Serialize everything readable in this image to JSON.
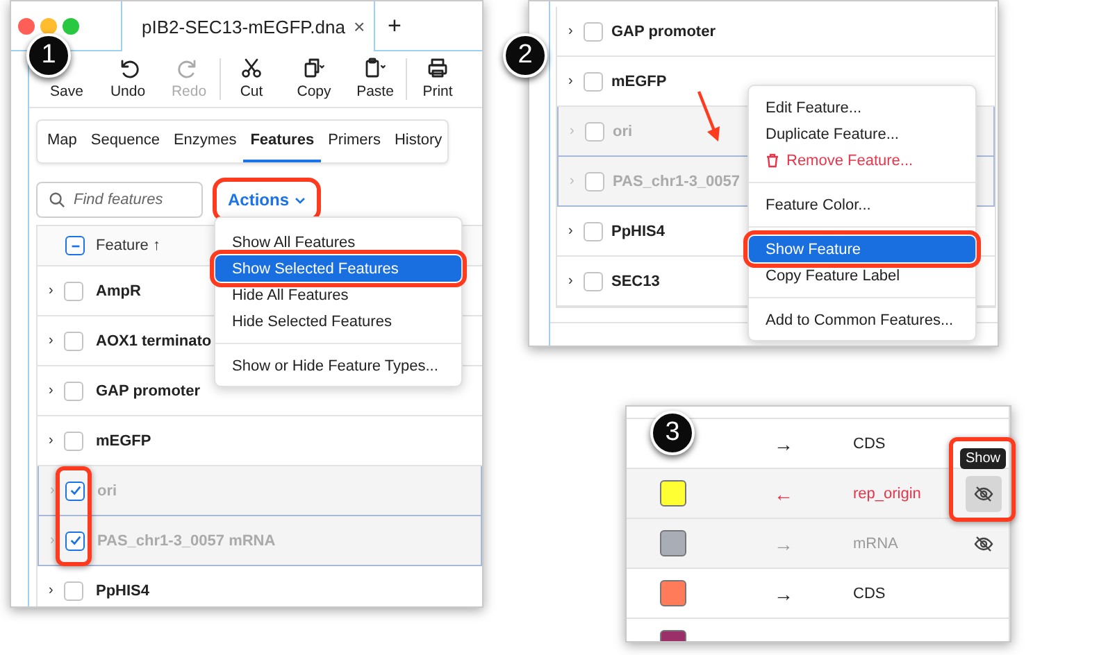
{
  "panel_1": {
    "step": "1",
    "tab": {
      "title": "pIB2-SEC13-mEGFP.dna",
      "close": "×"
    },
    "new_tab": "+",
    "toolbar": [
      {
        "label": "Save",
        "disabled": false,
        "separator_before": false
      },
      {
        "label": "Undo",
        "disabled": false,
        "separator_before": false
      },
      {
        "label": "Redo",
        "disabled": true,
        "separator_before": false
      },
      {
        "label": "Cut",
        "disabled": false,
        "separator_before": true
      },
      {
        "label": "Copy",
        "disabled": false,
        "separator_before": false
      },
      {
        "label": "Paste",
        "disabled": false,
        "separator_before": false
      },
      {
        "label": "Print",
        "disabled": false,
        "separator_before": true
      }
    ],
    "view_tabs": [
      {
        "label": "Map",
        "selected": false
      },
      {
        "label": "Sequence",
        "selected": false
      },
      {
        "label": "Enzymes",
        "selected": false
      },
      {
        "label": "Features",
        "selected": true
      },
      {
        "label": "Primers",
        "selected": false
      },
      {
        "label": "History",
        "selected": false
      }
    ],
    "search": {
      "placeholder": "Find features"
    },
    "actions": {
      "label": "Actions",
      "callout": true
    },
    "table": {
      "header": "Feature ↑",
      "partially_checked": true,
      "rows": [
        {
          "expander": "›",
          "name": "AmpR",
          "checked": false,
          "hidden": false,
          "callout": false
        },
        {
          "expander": "›",
          "name": "AOX1 terminato",
          "checked": false,
          "hidden": false,
          "callout": false
        },
        {
          "expander": "›",
          "name": "GAP promoter",
          "checked": false,
          "hidden": false,
          "callout": false
        },
        {
          "expander": "›",
          "name": "mEGFP",
          "checked": false,
          "hidden": false,
          "callout": false
        },
        {
          "expander": "›",
          "name": "ori",
          "checked": true,
          "hidden": true,
          "callout": true
        },
        {
          "expander": "›",
          "name": "PAS_chr1-3_0057 mRNA",
          "checked": true,
          "hidden": true,
          "callout": true
        },
        {
          "expander": "›",
          "name": "PpHIS4",
          "checked": false,
          "hidden": false,
          "callout": false
        }
      ]
    },
    "menu": [
      {
        "label": "Show All Features",
        "kind": "item",
        "selected": false,
        "callout": false,
        "divider_after": false
      },
      {
        "label": "Show Selected Features",
        "kind": "item",
        "selected": true,
        "callout": true,
        "divider_after": false
      },
      {
        "label": "Hide All Features",
        "kind": "item",
        "selected": false,
        "callout": false,
        "divider_after": false
      },
      {
        "label": "Hide Selected Features",
        "kind": "item",
        "selected": false,
        "callout": false,
        "divider_after": true
      },
      {
        "label": "Show or Hide Feature Types...",
        "kind": "item",
        "selected": false,
        "callout": false,
        "divider_after": false
      }
    ]
  },
  "panel_2": {
    "step": "2",
    "rows": [
      {
        "expander": "›",
        "name": "GAP promoter",
        "checked": false,
        "hidden": false
      },
      {
        "expander": "›",
        "name": "mEGFP",
        "checked": false,
        "hidden": false
      },
      {
        "expander": "›",
        "name": "ori",
        "checked": false,
        "hidden": true
      },
      {
        "expander": "›",
        "name": "PAS_chr1-3_0057",
        "checked": false,
        "hidden": true
      },
      {
        "expander": "›",
        "name": "PpHIS4",
        "checked": false,
        "hidden": false
      },
      {
        "expander": "›",
        "name": "SEC13",
        "checked": false,
        "hidden": false
      }
    ],
    "menu": [
      {
        "label": "Edit Feature...",
        "kind": "item",
        "selected": false,
        "callout": false,
        "divider_after": false
      },
      {
        "label": "Duplicate Feature...",
        "kind": "item",
        "selected": false,
        "callout": false,
        "divider_after": false
      },
      {
        "label": "Remove Feature...",
        "kind": "danger",
        "selected": false,
        "callout": false,
        "divider_after": true
      },
      {
        "label": "Feature Color...",
        "kind": "item",
        "selected": false,
        "callout": false,
        "divider_after": true
      },
      {
        "label": "Show Feature",
        "kind": "item",
        "selected": true,
        "callout": true,
        "divider_after": false
      },
      {
        "label": "Copy Feature Label",
        "kind": "item",
        "selected": false,
        "callout": false,
        "divider_after": true
      },
      {
        "label": "Add to Common Features...",
        "kind": "item",
        "selected": false,
        "callout": false,
        "divider_after": false
      }
    ]
  },
  "panel_3": {
    "step": "3",
    "rows": [
      {
        "arrow": "→",
        "type": "CDS",
        "highlighted": false,
        "muted": false,
        "hidden": false,
        "callout": false
      },
      {
        "color": "#ffff33",
        "arrow": "←",
        "type": "rep_origin",
        "highlighted": true,
        "muted": false,
        "hidden": true,
        "hovered": true,
        "tooltip": "Show",
        "callout": true
      },
      {
        "color": "#a9aeb6",
        "arrow": "→",
        "type": "mRNA",
        "highlighted": false,
        "muted": true,
        "hidden": true,
        "hovered": false,
        "callout": false
      },
      {
        "color": "#ff7b5a",
        "arrow": "→",
        "type": "CDS",
        "highlighted": false,
        "muted": false,
        "hidden": false,
        "callout": false
      },
      {
        "color": "#9b2f6a",
        "hidden": false,
        "callout": false
      }
    ]
  }
}
